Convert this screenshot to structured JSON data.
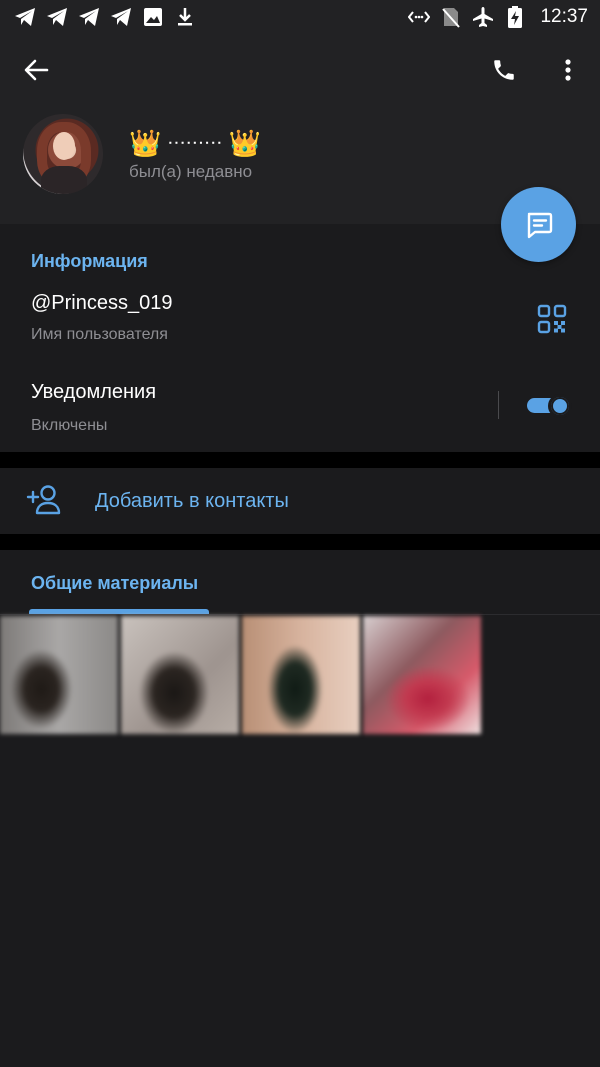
{
  "status_bar": {
    "time": "12:37",
    "left_icons": [
      "telegram-icon",
      "telegram-icon",
      "telegram-icon",
      "telegram-icon",
      "image-icon",
      "download-icon"
    ],
    "right_icons": [
      "data-saver-icon",
      "no-sim-icon",
      "airplane-icon",
      "battery-charging-icon"
    ]
  },
  "header": {
    "name": "ᐧᐧᐧᐧᐧᐧᐧᐧᐧ",
    "crown_left": "👑",
    "crown_right": "👑",
    "status": "был(а) недавно"
  },
  "info": {
    "title": "Информация",
    "username": "@Princess_019",
    "username_label": "Имя пользователя",
    "notifications_label": "Уведомления",
    "notifications_status": "Включены",
    "notifications_enabled": true
  },
  "add_contact": {
    "label": "Добавить в контакты"
  },
  "media": {
    "tab_label": "Общие материалы",
    "thumbnail_count": 4
  },
  "colors": {
    "accent": "#5aa2e4",
    "accent_text": "#6cb4f0",
    "background": "#1b1b1d",
    "header_bg": "#222224",
    "secondary_text": "#8e8e93"
  }
}
